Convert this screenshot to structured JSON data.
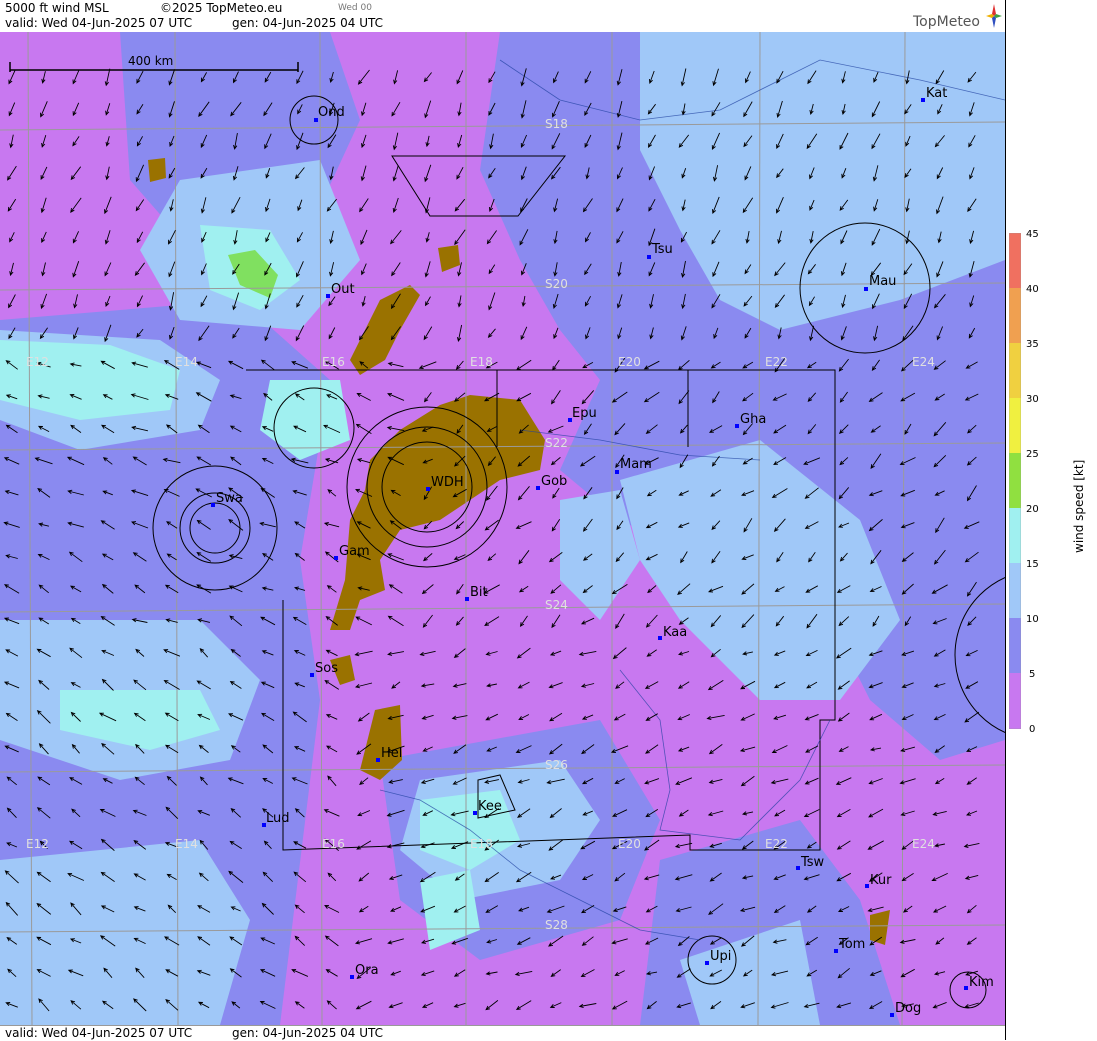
{
  "header": {
    "product": "5000 ft wind MSL",
    "copyright": "©2025 TopMeteo.eu",
    "run_tag": "Wed 00",
    "valid": "valid:  Wed  04-Jun-2025  07 UTC",
    "generated": "gen: 04-Jun-2025 04 UTC",
    "logo": "TopMeteo"
  },
  "footer": {
    "valid": "valid:  Wed  04-Jun-2025  07 UTC",
    "generated": "gen: 04-Jun-2025 04 UTC"
  },
  "scale_bar": {
    "label": "400 km"
  },
  "grid": {
    "lon_labels": [
      "E12",
      "E14",
      "E16",
      "E18",
      "E20",
      "E22",
      "E24"
    ],
    "lat_labels": [
      "S18",
      "S20",
      "S22",
      "S24",
      "S26",
      "S28"
    ]
  },
  "places": [
    {
      "name": "Ond"
    },
    {
      "name": "Kat"
    },
    {
      "name": "Tsu"
    },
    {
      "name": "Out"
    },
    {
      "name": "Mau"
    },
    {
      "name": "Epu"
    },
    {
      "name": "Gha"
    },
    {
      "name": "Mam"
    },
    {
      "name": "WDH"
    },
    {
      "name": "Gob"
    },
    {
      "name": "Swa"
    },
    {
      "name": "Gam"
    },
    {
      "name": "Bit"
    },
    {
      "name": "Kaa"
    },
    {
      "name": "Sos"
    },
    {
      "name": "Hel"
    },
    {
      "name": "Kee"
    },
    {
      "name": "Lud"
    },
    {
      "name": "Tsw"
    },
    {
      "name": "Kur"
    },
    {
      "name": "Tom"
    },
    {
      "name": "Upi"
    },
    {
      "name": "Ora"
    },
    {
      "name": "Kim"
    },
    {
      "name": "Dog"
    }
  ],
  "legend": {
    "title": "wind speed [kt]",
    "ticks": [
      "45",
      "40",
      "35",
      "30",
      "25",
      "20",
      "15",
      "10",
      "5",
      "0"
    ],
    "colors": [
      "#f07060",
      "#f0a050",
      "#f0d040",
      "#f0f040",
      "#90e040",
      "#50e050",
      "#a0f0f0",
      "#a0c8f8",
      "#8a8af0",
      "#c878f0"
    ]
  },
  "colors": {
    "calm": "#c878f0",
    "light": "#8a8af0",
    "moderate": "#a0c8f8",
    "fresh": "#a0f0f0",
    "strong": "#80e060",
    "terrain": "#9a7200"
  }
}
